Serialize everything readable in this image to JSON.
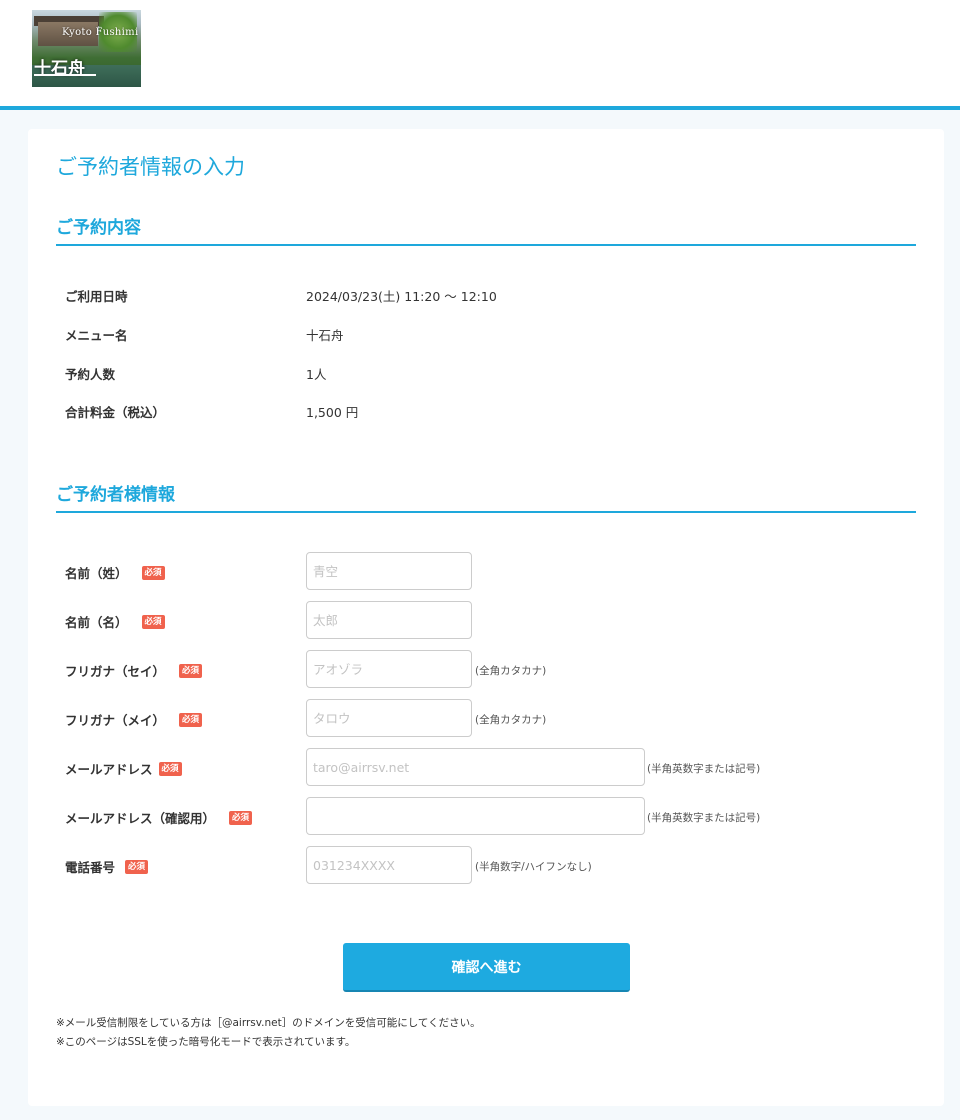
{
  "logo": {
    "subtitle": "Kyoto  Fushimi",
    "name": "十石舟"
  },
  "page_title": "ご予約者情報の入力",
  "reservation": {
    "section_title": "ご予約内容",
    "rows": [
      {
        "label": "ご利用日時",
        "value": "2024/03/23(土) 11:20 〜 12:10"
      },
      {
        "label": "メニュー名",
        "value": "十石舟"
      },
      {
        "label": "予約人数",
        "value": "1人"
      },
      {
        "label": "合計料金（税込）",
        "value": "1,500 円"
      }
    ]
  },
  "customer": {
    "section_title": "ご予約者様情報",
    "required_badge": "必須",
    "fields": [
      {
        "label": "名前（姓）",
        "placeholder": "青空",
        "value": "",
        "hint": ""
      },
      {
        "label": "名前（名）",
        "placeholder": "太郎",
        "value": "",
        "hint": ""
      },
      {
        "label": "フリガナ（セイ）",
        "placeholder": "アオゾラ",
        "value": "",
        "hint": "(全角カタカナ)"
      },
      {
        "label": "フリガナ（メイ）",
        "placeholder": "タロウ",
        "value": "",
        "hint": "(全角カタカナ)"
      },
      {
        "label": "メールアドレス",
        "placeholder": "taro@airrsv.net",
        "value": "",
        "hint": "(半角英数字または記号)"
      },
      {
        "label": "メールアドレス（確認用）",
        "placeholder": "",
        "value": "",
        "hint": "(半角英数字または記号)"
      },
      {
        "label": "電話番号",
        "placeholder": "031234XXXX",
        "value": "",
        "hint": "(半角数字/ハイフンなし)"
      }
    ]
  },
  "submit_label": "確認へ進む",
  "notes": [
    "※メール受信制限をしている方は［@airrsv.net］のドメインを受信可能にしてください。",
    "※このページはSSLを使った暗号化モードで表示されています。"
  ],
  "colors": {
    "accent": "#1ea8dc",
    "required": "#f0624d",
    "background": "#f4f9fc"
  }
}
